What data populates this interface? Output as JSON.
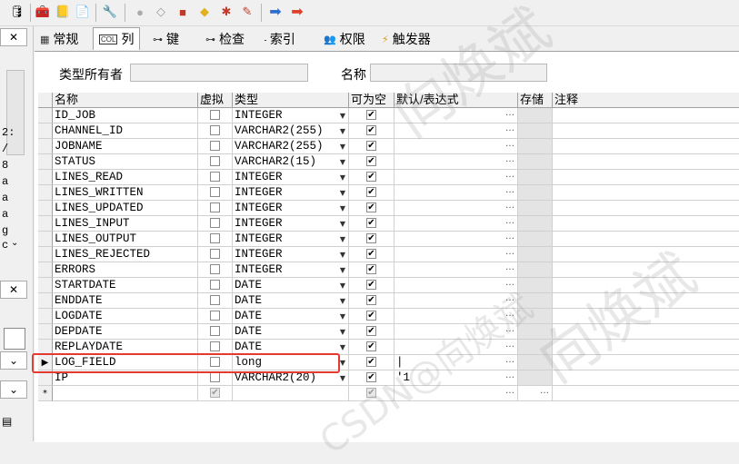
{
  "toolbar": {
    "icons": [
      "db-connect-icon",
      "tools-icon",
      "notepad-icon",
      "document-icon",
      "wrench-icon",
      "sql-exec-icon",
      "eraser-icon",
      "red-book-icon",
      "yellow-arrow-icon",
      "red-gear-icon",
      "broom-icon",
      "arrow-right-blue-icon",
      "arrow-right-red-icon"
    ]
  },
  "left_panel": {
    "chars": [
      "2:",
      "/",
      "8",
      "a",
      "a",
      "a",
      "g",
      "c"
    ]
  },
  "tabs": [
    {
      "label": "常规",
      "icon": "general-icon"
    },
    {
      "label": "列",
      "icon": "column-icon"
    },
    {
      "label": "键",
      "icon": "key-icon"
    },
    {
      "label": "检查",
      "icon": "check-icon"
    },
    {
      "label": "索引",
      "icon": "index-icon"
    },
    {
      "label": "权限",
      "icon": "privilege-icon"
    },
    {
      "label": "触发器",
      "icon": "trigger-icon"
    }
  ],
  "form": {
    "owner_label": "类型所有者",
    "owner_value": "",
    "name_label": "名称",
    "name_value": ""
  },
  "grid": {
    "headers": [
      "名称",
      "虚拟",
      "类型",
      "可为空",
      "默认/表达式",
      "存储",
      "注释"
    ],
    "rows": [
      {
        "name": "ID_JOB",
        "virtual": false,
        "type": "INTEGER",
        "nullable": true,
        "default": ""
      },
      {
        "name": "CHANNEL_ID",
        "virtual": false,
        "type": "VARCHAR2(255)",
        "nullable": true,
        "default": ""
      },
      {
        "name": "JOBNAME",
        "virtual": false,
        "type": "VARCHAR2(255)",
        "nullable": true,
        "default": ""
      },
      {
        "name": "STATUS",
        "virtual": false,
        "type": "VARCHAR2(15)",
        "nullable": true,
        "default": ""
      },
      {
        "name": "LINES_READ",
        "virtual": false,
        "type": "INTEGER",
        "nullable": true,
        "default": ""
      },
      {
        "name": "LINES_WRITTEN",
        "virtual": false,
        "type": "INTEGER",
        "nullable": true,
        "default": ""
      },
      {
        "name": "LINES_UPDATED",
        "virtual": false,
        "type": "INTEGER",
        "nullable": true,
        "default": ""
      },
      {
        "name": "LINES_INPUT",
        "virtual": false,
        "type": "INTEGER",
        "nullable": true,
        "default": ""
      },
      {
        "name": "LINES_OUTPUT",
        "virtual": false,
        "type": "INTEGER",
        "nullable": true,
        "default": ""
      },
      {
        "name": "LINES_REJECTED",
        "virtual": false,
        "type": "INTEGER",
        "nullable": true,
        "default": ""
      },
      {
        "name": "ERRORS",
        "virtual": false,
        "type": "INTEGER",
        "nullable": true,
        "default": ""
      },
      {
        "name": "STARTDATE",
        "virtual": false,
        "type": "DATE",
        "nullable": true,
        "default": ""
      },
      {
        "name": "ENDDATE",
        "virtual": false,
        "type": "DATE",
        "nullable": true,
        "default": ""
      },
      {
        "name": "LOGDATE",
        "virtual": false,
        "type": "DATE",
        "nullable": true,
        "default": ""
      },
      {
        "name": "DEPDATE",
        "virtual": false,
        "type": "DATE",
        "nullable": true,
        "default": ""
      },
      {
        "name": "REPLAYDATE",
        "virtual": false,
        "type": "DATE",
        "nullable": true,
        "default": ""
      },
      {
        "name": "LOG_FIELD",
        "virtual": false,
        "type": "long",
        "nullable": true,
        "default": "|"
      },
      {
        "name": "IP",
        "virtual": false,
        "type": "VARCHAR2(20)",
        "nullable": true,
        "default": "'1"
      }
    ],
    "current_row_marker": "▶",
    "new_row_marker": "*",
    "highlighted_row": "LOG_FIELD"
  },
  "watermark": {
    "text": "向焕斌",
    "text2": "CSDN@向焕斌"
  },
  "colors": {
    "highlight": "#e53a32",
    "window_bg": "#f0f0f0"
  }
}
